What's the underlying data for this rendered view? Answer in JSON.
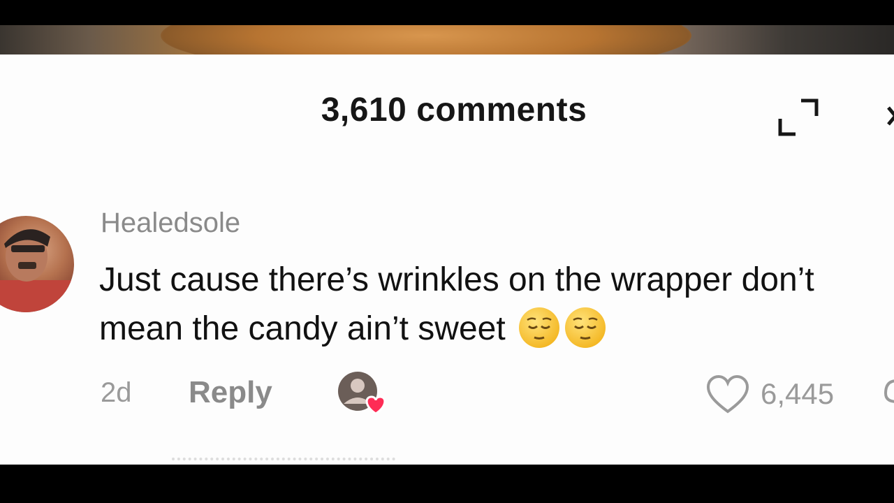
{
  "sheet": {
    "title": "3,610 comments",
    "expand_icon": "expand-icon",
    "close_icon": "close-icon"
  },
  "comment": {
    "username": "Healedsole",
    "text": "Just cause there’s wrinkles on the wrapper don’t mean the candy ain’t sweet",
    "emojis": [
      "relieved-face",
      "relieved-face"
    ],
    "age": "2d",
    "reply_label": "Reply",
    "like_count": "6,445",
    "creator_liked": true
  },
  "colors": {
    "like_heart_accent": "#fe2c55",
    "text_primary": "#161616",
    "text_secondary": "#8a8a8a"
  }
}
